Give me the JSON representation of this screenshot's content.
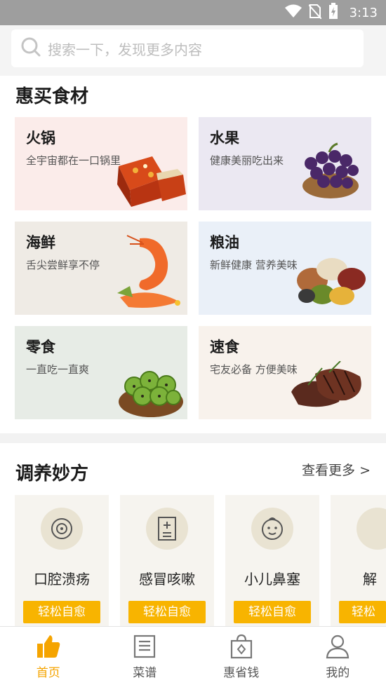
{
  "status_bar": {
    "time": "3:13"
  },
  "search": {
    "placeholder": "搜索一下，发现更多内容"
  },
  "section_ingredients": {
    "title": "惠买食材",
    "items": [
      {
        "title": "火锅",
        "subtitle": "全宇宙都在一口锅里",
        "bg": "#fbecea",
        "image": "hotpot-base-icon"
      },
      {
        "title": "水果",
        "subtitle": "健康美丽吃出来",
        "bg": "#ebe8f2",
        "image": "grapes-icon"
      },
      {
        "title": "海鲜",
        "subtitle": "舌尖尝鲜享不停",
        "bg": "#efebe5",
        "image": "shrimp-icon"
      },
      {
        "title": "粮油",
        "subtitle": "新鲜健康 营养美味",
        "bg": "#eaf0f8",
        "image": "beans-icon"
      },
      {
        "title": "零食",
        "subtitle": "一直吃一直爽",
        "bg": "#e7ece6",
        "image": "kiwi-chips-icon"
      },
      {
        "title": "速食",
        "subtitle": "宅友必备 方便美味",
        "bg": "#f8f2ec",
        "image": "steak-icon"
      }
    ]
  },
  "section_remedies": {
    "title": "调养妙方",
    "more": "查看更多 >",
    "items": [
      {
        "name": "口腔溃疡",
        "button": "轻松自愈",
        "icon": "mouth-icon"
      },
      {
        "name": "感冒咳嗽",
        "button": "轻松自愈",
        "icon": "medical-book-icon"
      },
      {
        "name": "小儿鼻塞",
        "button": "轻松自愈",
        "icon": "baby-face-icon"
      },
      {
        "name": "解",
        "button": "轻松",
        "icon": "partial-icon"
      }
    ]
  },
  "bottom_nav": {
    "items": [
      {
        "label": "首页",
        "icon": "thumbs-up-icon",
        "active": true
      },
      {
        "label": "菜谱",
        "icon": "recipe-book-icon",
        "active": false
      },
      {
        "label": "惠省钱",
        "icon": "shopping-bag-icon",
        "active": false
      },
      {
        "label": "我的",
        "icon": "person-icon",
        "active": false
      }
    ]
  },
  "colors": {
    "accent": "#f8b400",
    "nav_active": "#f5a400"
  }
}
